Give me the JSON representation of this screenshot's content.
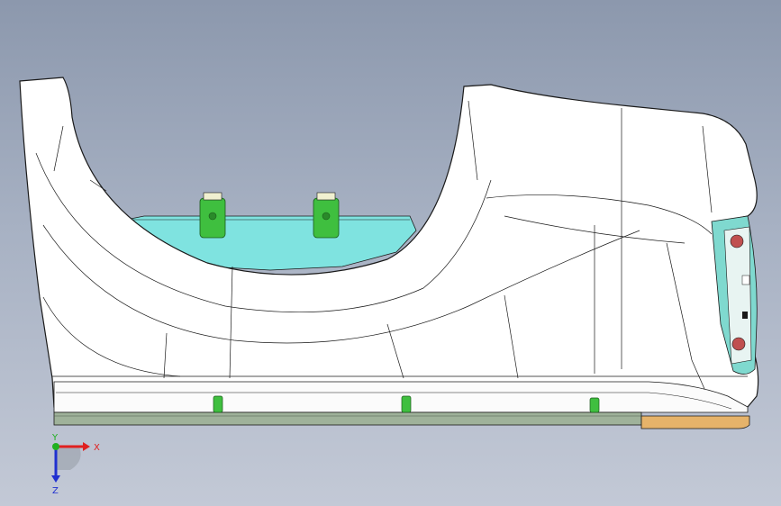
{
  "viewport": {
    "background_top": "#8c98ad",
    "background_bottom": "#c3c9d6"
  },
  "model": {
    "body_color": "#ffffff",
    "edge_color": "#1a1a1a",
    "inner_tray_color": "#7fe3e0",
    "clip_color": "#3fbf3f",
    "base_strip_color": "#9fb29a",
    "end_cap_color": "#e6b36a",
    "end_cavity_color": "#7fd9cf"
  },
  "triad": {
    "x_label": "X",
    "y_label": "Y",
    "z_label": "Z",
    "x_color": "#e02020",
    "y_color": "#20b020",
    "z_color": "#2030d0"
  }
}
